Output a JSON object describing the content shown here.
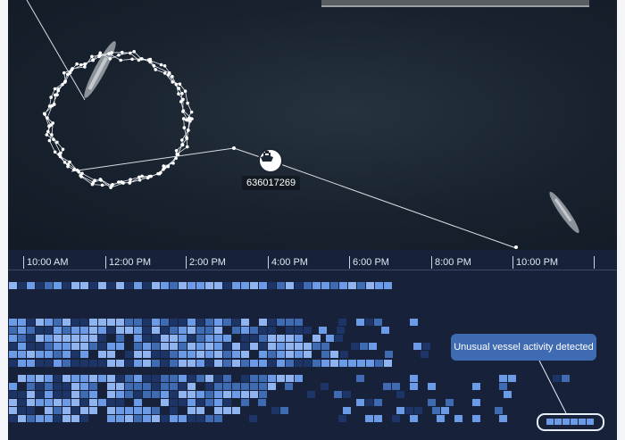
{
  "map": {
    "vessel_id": "636017269",
    "vessel_icon": "ship-icon"
  },
  "timeline": {
    "ticks": [
      "10:00 AM",
      "12:00 PM",
      "2:00 PM",
      "4:00 PM",
      "6:00 PM",
      "8:00 PM",
      "10:00 PM"
    ],
    "alert_text": "Unusual vessel activity detected"
  },
  "colors": {
    "timeline_bg": "#17223a",
    "cell_light": "#6b9be6",
    "cell_mid": "#3f6bb3",
    "cell_dark": "#1d3566",
    "alert_bg": "#3f6bb3"
  }
}
